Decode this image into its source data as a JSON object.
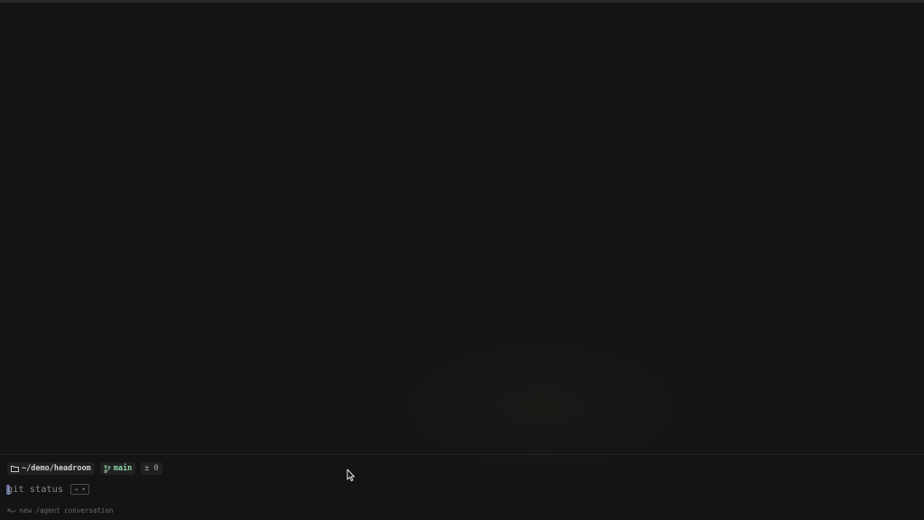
{
  "context": {
    "directory": "~/demo/headroom",
    "branch": "main",
    "changes": "± 0"
  },
  "input": {
    "value": "git status",
    "shortcut_badge": "→ ▾"
  },
  "hint": {
    "text": "⌘↵ new /agent conversation"
  },
  "icons": {
    "folder": "folder-icon",
    "branch": "git-branch-icon",
    "pointer": "mouse-pointer-icon"
  }
}
